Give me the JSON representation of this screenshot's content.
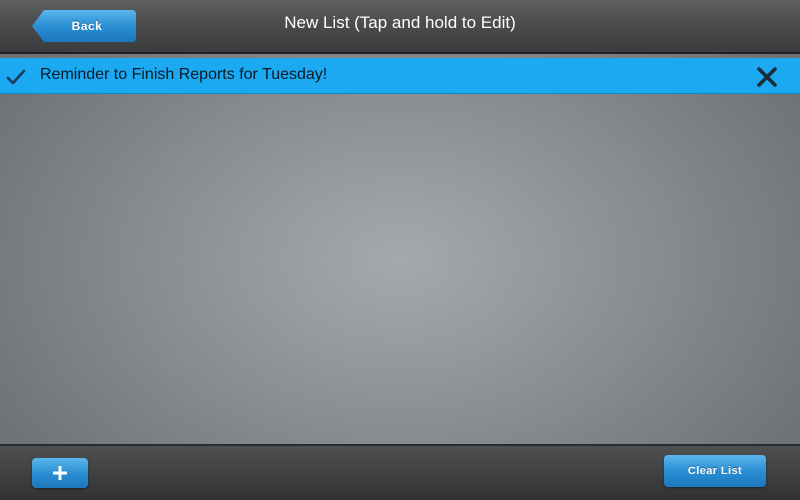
{
  "header": {
    "back_label": "Back",
    "title": "New List (Tap and hold to Edit)"
  },
  "list": {
    "items": [
      {
        "text": "Reminder to Finish Reports for Tuesday!",
        "checked": true,
        "check_icon": "checkmark-icon",
        "delete_icon": "close-icon"
      }
    ]
  },
  "footer": {
    "add_icon": "plus-icon",
    "clear_label": "Clear List"
  },
  "colors": {
    "accent": "#2a8fd4",
    "selected_row": "#1ba9f2",
    "bar": "#4a4c4e"
  }
}
